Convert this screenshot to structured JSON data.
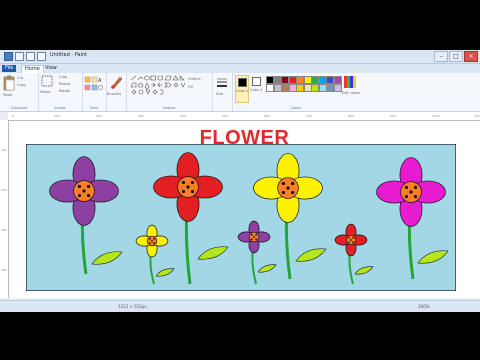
{
  "window": {
    "title": "Untitled - Paint",
    "minimize_glyph": "–",
    "maximize_glyph": "□",
    "close_glyph": "×"
  },
  "tabs": [
    "File",
    "Home",
    "View"
  ],
  "ribbon": {
    "clipboard": {
      "paste": "Paste",
      "cut": "Cut",
      "copy": "Copy",
      "label": "Clipboard"
    },
    "image": {
      "select": "Select",
      "crop": "Crop",
      "resize": "Resize",
      "rotate": "Rotate",
      "label": "Image"
    },
    "tools": {
      "label": "Tools"
    },
    "brushes": {
      "label": "Brushes"
    },
    "shapes": {
      "outline": "Outline",
      "fill": "Fill",
      "label": "Shapes"
    },
    "size": {
      "label": "Size"
    },
    "color1": {
      "label": "Color 1"
    },
    "color2": {
      "label": "Color 2"
    },
    "edit_colors": {
      "label": "Edit colors"
    },
    "colors_group": {
      "label": "Colors"
    }
  },
  "palette": [
    "#000000",
    "#7f7f7f",
    "#880015",
    "#ed1c24",
    "#ff7f27",
    "#fff200",
    "#22b14c",
    "#00a2e8",
    "#3f48cc",
    "#a349a4",
    "#ffffff",
    "#c3c3c3",
    "#b97a57",
    "#ffaec9",
    "#ffc90e",
    "#efe4b0",
    "#b5e61d",
    "#99d9ea",
    "#7092be",
    "#c8bfe7"
  ],
  "rulers": {
    "top": [
      "0",
      "100",
      "200",
      "300",
      "400",
      "500",
      "600",
      "700",
      "800",
      "900",
      "1000",
      "1100"
    ],
    "left": [
      "100",
      "200",
      "300",
      "400"
    ]
  },
  "canvas": {
    "heading": "FLOWER",
    "scene_bg": "#a2d8e6",
    "accent": "#e8262b"
  },
  "status": {
    "size": "1213 × 552px",
    "zoom": "100%"
  }
}
